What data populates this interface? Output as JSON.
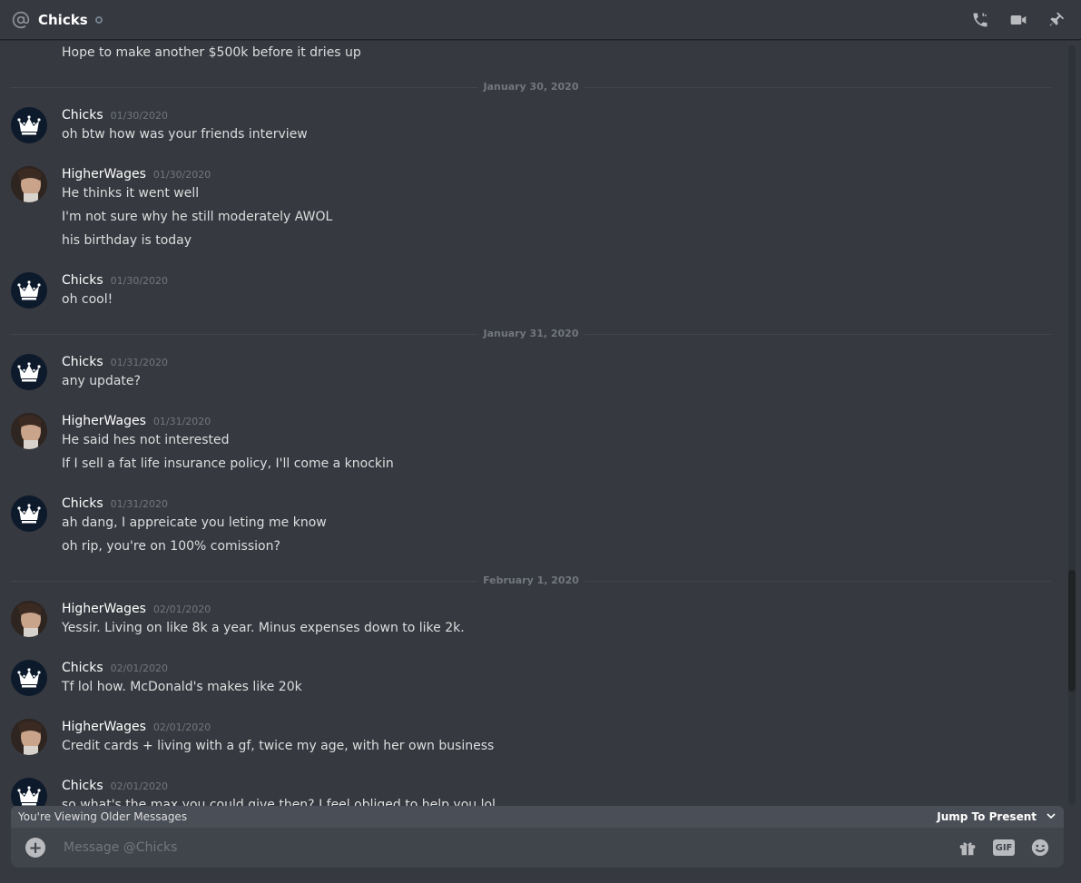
{
  "header": {
    "title": "Chicks",
    "icons": [
      "at-icon",
      "phone-call-icon",
      "video-call-icon",
      "pin-icon"
    ]
  },
  "messages": {
    "top_line": "Hope to make another $500k before it dries up",
    "dividers": [
      "January 30, 2020",
      "January 31, 2020",
      "February 1, 2020"
    ],
    "groups": [
      {
        "author": "Chicks",
        "timestamp": "01/30/2020",
        "lines": [
          "oh btw how was your friends interview"
        ]
      },
      {
        "author": "HigherWages",
        "timestamp": "01/30/2020",
        "lines": [
          "He thinks it went well",
          "I'm not sure why he still moderately AWOL",
          "his birthday is today"
        ]
      },
      {
        "author": "Chicks",
        "timestamp": "01/30/2020",
        "lines": [
          "oh cool!"
        ]
      },
      {
        "author": "Chicks",
        "timestamp": "01/31/2020",
        "lines": [
          "any update?"
        ]
      },
      {
        "author": "HigherWages",
        "timestamp": "01/31/2020",
        "lines": [
          "He said hes not interested",
          "If I sell a fat life insurance policy, I'll come a knockin"
        ]
      },
      {
        "author": "Chicks",
        "timestamp": "01/31/2020",
        "lines": [
          "ah dang, I appreicate you leting me know",
          "oh rip, you're on 100% comission?"
        ]
      },
      {
        "author": "HigherWages",
        "timestamp": "02/01/2020",
        "lines": [
          "Yessir. Living on like 8k a year. Minus expenses down to like 2k."
        ]
      },
      {
        "author": "Chicks",
        "timestamp": "02/01/2020",
        "lines": [
          "Tf lol how. McDonald's makes like 20k"
        ]
      },
      {
        "author": "HigherWages",
        "timestamp": "02/01/2020",
        "lines": [
          "Credit cards + living with a gf, twice my age, with her own business"
        ]
      },
      {
        "author": "Chicks",
        "timestamp": "02/01/2020",
        "lines": [
          "so what's the max you could give then? I feel obliged to help you lol"
        ]
      }
    ]
  },
  "older_bar": {
    "label": "You're Viewing Older Messages",
    "jump_label": "Jump To Present"
  },
  "composer": {
    "placeholder": "Message @Chicks",
    "gif_label": "GIF"
  }
}
